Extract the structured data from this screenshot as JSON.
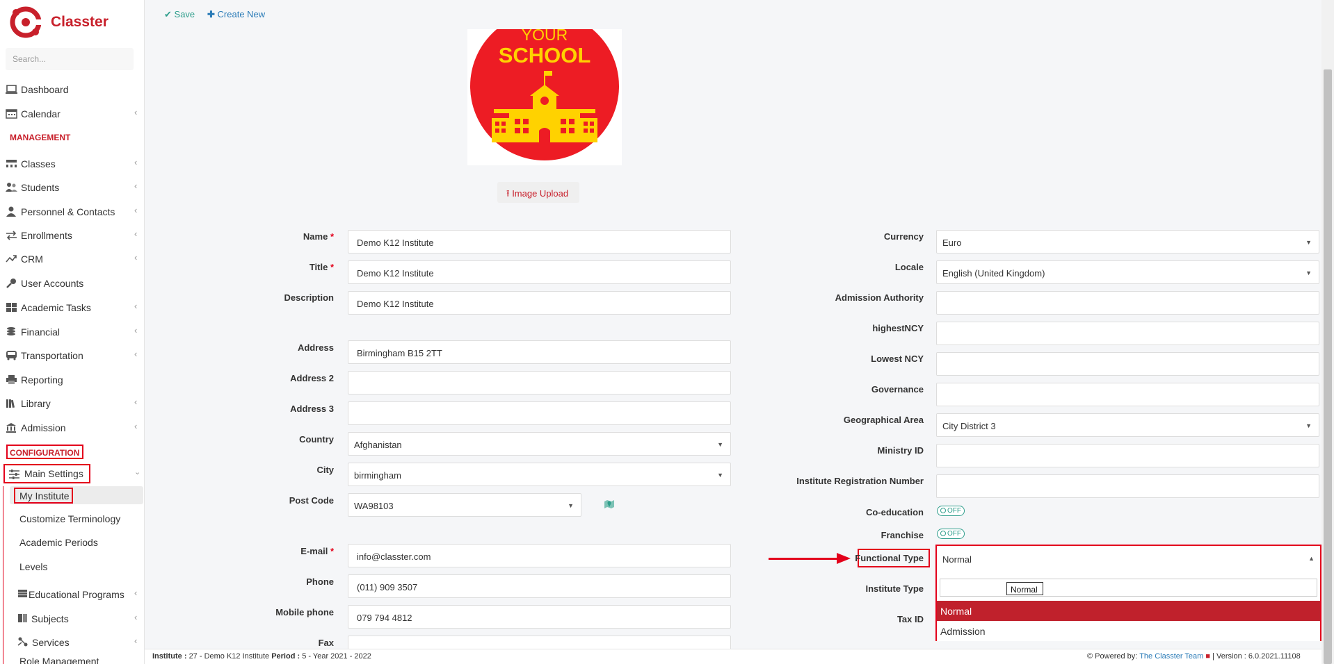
{
  "app": {
    "brand": "Classter"
  },
  "search": {
    "placeholder": "Search..."
  },
  "sidebar": {
    "items": [
      {
        "label": "Dashboard",
        "icon": "laptop-icon",
        "chev": false
      },
      {
        "label": "Calendar",
        "icon": "calendar-icon",
        "chev": true
      }
    ],
    "management_label": "MANAGEMENT",
    "management": [
      {
        "label": "Classes",
        "icon": "classes-icon",
        "chev": true
      },
      {
        "label": "Students",
        "icon": "students-icon",
        "chev": true
      },
      {
        "label": "Personnel & Contacts",
        "icon": "personnel-icon",
        "chev": true
      },
      {
        "label": "Enrollments",
        "icon": "enrollments-icon",
        "chev": true
      },
      {
        "label": "CRM",
        "icon": "crm-icon",
        "chev": true
      },
      {
        "label": "User Accounts",
        "icon": "key-icon",
        "chev": false
      },
      {
        "label": "Academic Tasks",
        "icon": "grid-icon",
        "chev": true
      },
      {
        "label": "Financial",
        "icon": "coins-icon",
        "chev": true
      },
      {
        "label": "Transportation",
        "icon": "bus-icon",
        "chev": true
      },
      {
        "label": "Reporting",
        "icon": "printer-icon",
        "chev": false
      },
      {
        "label": "Library",
        "icon": "library-icon",
        "chev": true
      },
      {
        "label": "Admission",
        "icon": "bank-icon",
        "chev": true
      }
    ],
    "config_label": "CONFIGURATION",
    "main_settings": "Main Settings",
    "subitems": [
      "My Institute",
      "Customize Terminology",
      "Academic Periods",
      "Levels"
    ],
    "subgroups": [
      {
        "label": "Educational Programs",
        "icon": "programs-icon"
      },
      {
        "label": "Subjects",
        "icon": "book-icon"
      },
      {
        "label": "Services",
        "icon": "services-icon"
      }
    ],
    "role_management": "Role Management"
  },
  "toolbar": {
    "save": "Save",
    "create_new": "Create New"
  },
  "logo": {
    "line1": "YOUR",
    "line2": "SCHOOL"
  },
  "image_upload": "Image Upload",
  "left_form": {
    "name": {
      "label": "Name",
      "value": "Demo K12 Institute"
    },
    "title": {
      "label": "Title",
      "value": "Demo K12 Institute"
    },
    "description": {
      "label": "Description",
      "value": "Demo K12 Institute"
    },
    "address": {
      "label": "Address",
      "value": "Birmingham B15 2TT"
    },
    "address2": {
      "label": "Address 2",
      "value": ""
    },
    "address3": {
      "label": "Address 3",
      "value": ""
    },
    "country": {
      "label": "Country",
      "value": "Afghanistan"
    },
    "city": {
      "label": "City",
      "value": "birmingham"
    },
    "postcode": {
      "label": "Post Code",
      "value": "WA98103"
    },
    "email": {
      "label": "E-mail",
      "value": "info@classter.com"
    },
    "phone": {
      "label": "Phone",
      "value": "(011) 909 3507"
    },
    "mobile": {
      "label": "Mobile phone",
      "value": "079 794 4812"
    },
    "fax": {
      "label": "Fax",
      "value": ""
    }
  },
  "right_form": {
    "currency": {
      "label": "Currency",
      "value": "Euro"
    },
    "locale": {
      "label": "Locale",
      "value": "English (United Kingdom)"
    },
    "admission_authority": {
      "label": "Admission Authority",
      "value": ""
    },
    "highest_ncy": {
      "label": "highestNCY",
      "value": ""
    },
    "lowest_ncy": {
      "label": "Lowest NCY",
      "value": ""
    },
    "governance": {
      "label": "Governance",
      "value": ""
    },
    "geo_area": {
      "label": "Geographical Area",
      "value": "City District 3"
    },
    "ministry_id": {
      "label": "Ministry ID",
      "value": ""
    },
    "reg_number": {
      "label": "Institute Registration Number",
      "value": ""
    },
    "coeducation": {
      "label": "Co-education",
      "value": "OFF"
    },
    "franchise": {
      "label": "Franchise",
      "value": "OFF"
    },
    "functional_type": {
      "label": "Functional Type",
      "value": "Normal"
    },
    "institute_type": {
      "label": "Institute Type"
    },
    "tax_id": {
      "label": "Tax ID"
    }
  },
  "dropdown": {
    "search_value": "",
    "tooltip": "Normal",
    "options": [
      "Normal",
      "Admission"
    ]
  },
  "footer": {
    "institute_label": "Institute :",
    "institute_value": "27 - Demo K12 Institute",
    "period_label": "Period :",
    "period_value": "5 - Year 2021 - 2022",
    "powered_label": "Powered by:",
    "powered_team": "The Classter Team",
    "version_label": "| Version :",
    "version_value": "6.0.2021.11108"
  },
  "colors": {
    "brand": "#c8202b",
    "accent": "#2a7bb7",
    "highlight": "#e3001b",
    "selected_option": "#c0212c"
  }
}
